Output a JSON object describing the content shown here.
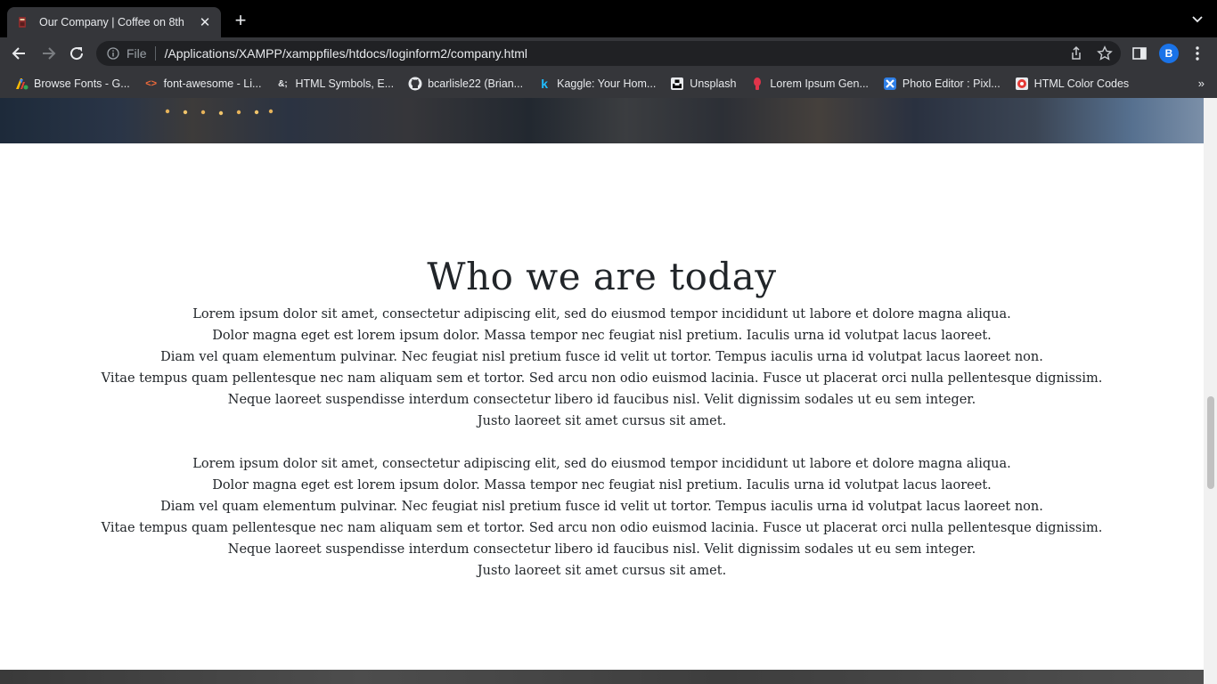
{
  "browser": {
    "tab": {
      "title": "Our Company | Coffee on 8th"
    },
    "address_bar": {
      "scheme_label": "File",
      "url": "/Applications/XAMPP/xamppfiles/htdocs/loginform2/company.html"
    },
    "profile_initial": "B",
    "bookmarks": [
      {
        "label": "Browse Fonts - G...",
        "icon": "google-fonts-icon"
      },
      {
        "label": "font-awesome - Li...",
        "icon": "code-brackets-icon"
      },
      {
        "label": "HTML Symbols, E...",
        "icon": "ampersand-icon",
        "glyph": "&;"
      },
      {
        "label": "bcarlisle22 (Brian...",
        "icon": "github-icon"
      },
      {
        "label": "Kaggle: Your Hom...",
        "icon": "kaggle-icon",
        "glyph": "k"
      },
      {
        "label": "Unsplash",
        "icon": "unsplash-icon"
      },
      {
        "label": "Lorem Ipsum Gen...",
        "icon": "lorem-ipsum-icon"
      },
      {
        "label": "Photo Editor : Pixl...",
        "icon": "pixlr-icon"
      },
      {
        "label": "HTML Color Codes",
        "icon": "color-picker-icon"
      }
    ],
    "bookmarks_more": "»"
  },
  "page": {
    "heading": "Who we are today",
    "paragraphs": [
      [
        "Lorem ipsum dolor sit amet, consectetur adipiscing elit, sed do eiusmod tempor incididunt ut labore et dolore magna aliqua.",
        "Dolor magna eget est lorem ipsum dolor. Massa tempor nec feugiat nisl pretium. Iaculis urna id volutpat lacus laoreet.",
        "Diam vel quam elementum pulvinar. Nec feugiat nisl pretium fusce id velit ut tortor. Tempus iaculis urna id volutpat lacus laoreet non.",
        "Vitae tempus quam pellentesque nec nam aliquam sem et tortor. Sed arcu non odio euismod lacinia. Fusce ut placerat orci nulla pellentesque dignissim.",
        "Neque laoreet suspendisse interdum consectetur libero id faucibus nisl. Velit dignissim sodales ut eu sem integer.",
        "Justo laoreet sit amet cursus sit amet."
      ],
      [
        "Lorem ipsum dolor sit amet, consectetur adipiscing elit, sed do eiusmod tempor incididunt ut labore et dolore magna aliqua.",
        "Dolor magna eget est lorem ipsum dolor. Massa tempor nec feugiat nisl pretium. Iaculis urna id volutpat lacus laoreet.",
        "Diam vel quam elementum pulvinar. Nec feugiat nisl pretium fusce id velit ut tortor. Tempus iaculis urna id volutpat lacus laoreet non.",
        "Vitae tempus quam pellentesque nec nam aliquam sem et tortor. Sed arcu non odio euismod lacinia. Fusce ut placerat orci nulla pellentesque dignissim.",
        "Neque laoreet suspendisse interdum consectetur libero id faucibus nisl. Velit dignissim sodales ut eu sem integer.",
        "Justo laoreet sit amet cursus sit amet."
      ]
    ]
  },
  "colors": {
    "tabstrip": "#000000",
    "toolbar": "#35363a",
    "omnibox": "#202124",
    "page_text": "#212529",
    "page_background": "#ffffff",
    "profile_accent": "#1a73e8"
  }
}
